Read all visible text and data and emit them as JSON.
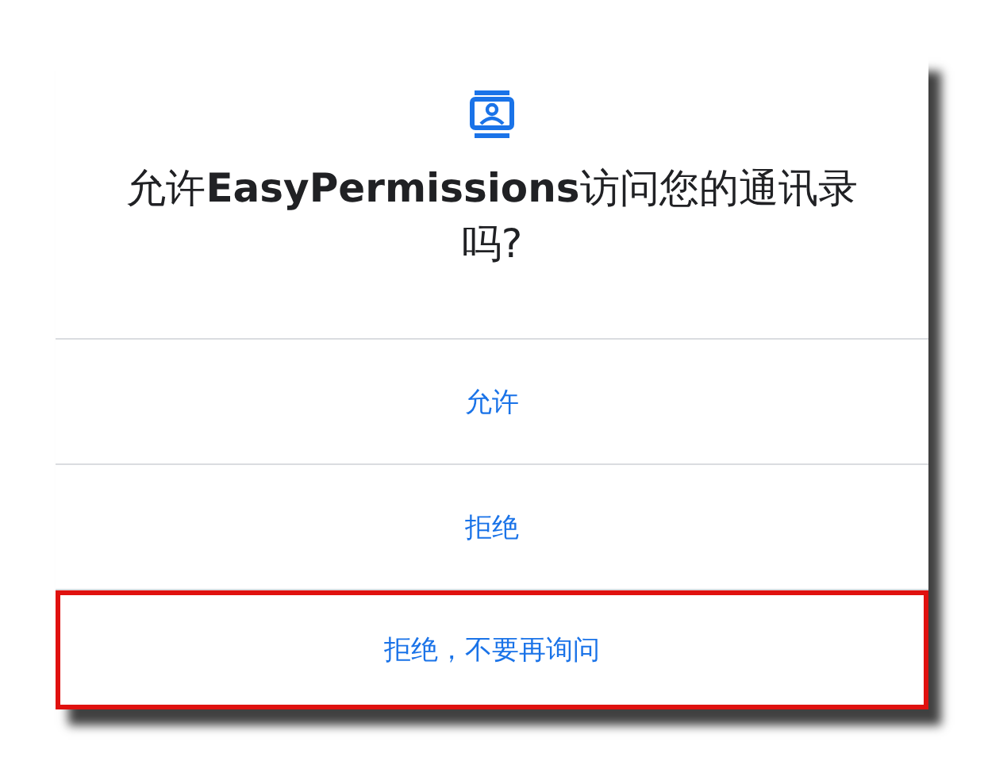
{
  "dialog": {
    "title": "允许**EasyPermissions**访问您的通讯录吗?",
    "buttons": [
      {
        "label": "允许",
        "highlighted": false
      },
      {
        "label": "拒绝",
        "highlighted": false
      },
      {
        "label": "拒绝，不要再询问",
        "highlighted": true
      }
    ]
  }
}
